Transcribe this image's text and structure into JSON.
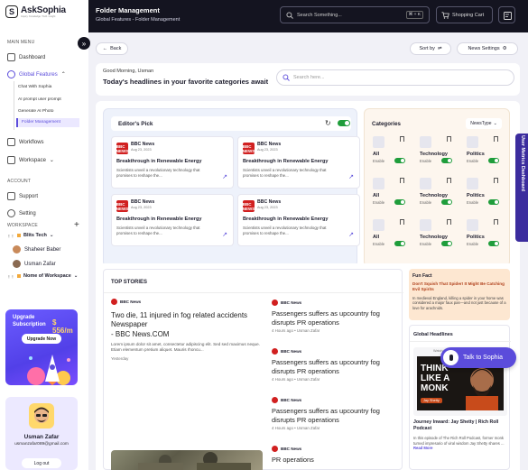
{
  "app": {
    "name": "AskSophia",
    "tagline": "Inquiry. Knowledge. Truth. Insight"
  },
  "sidebar": {
    "main_menu_label": "MAIN MENU",
    "items": [
      {
        "label": "Dashboard"
      },
      {
        "label": "Global Features"
      },
      {
        "label": "Workflows"
      },
      {
        "label": "Workspace"
      }
    ],
    "sub_items": [
      "Chat With Sophia",
      "AI prompt user prompt",
      "Generate AI Photo",
      "Folder Management"
    ],
    "account_label": "ACCOUNT",
    "account_items": [
      {
        "label": "Support"
      },
      {
        "label": "Setting"
      }
    ],
    "workspace_label": "WORKSPACE",
    "workspaces": [
      {
        "name": "Blits Tech",
        "members": [
          "Shaheer Baber",
          "Usman Zafar"
        ]
      },
      {
        "name": "Nome of Workspace"
      }
    ],
    "upgrade": {
      "line1": "Upgrade",
      "line2": "Subscription",
      "price": "$ 556/m",
      "button": "Upgrade Now"
    },
    "profile": {
      "name": "Usman Zafar",
      "email": "usmanzafar089@gmail.com",
      "logout": "Log out"
    }
  },
  "topbar": {
    "title": "Folder Management",
    "breadcrumb": "Global Features - Folder Management",
    "search_placeholder": "Search Something...",
    "shortcut": "⌘ + K",
    "cart": "Shopping Cart"
  },
  "toolbar": {
    "back": "Back",
    "sort": "Sort by",
    "news_settings": "News Settings"
  },
  "greeting": {
    "hello": "Good Morning, Usman",
    "headline": "Today's headlines in your favorite categories await",
    "search_placeholder": "Search here..."
  },
  "editors_pick": {
    "title": "Editor's Pick",
    "cards": [
      {
        "logo": "BBC NEWS",
        "source": "BBC News",
        "date": "Aug 23, 2023",
        "title": "Breakthrough in Renewable Energy",
        "desc": "Scientists unveil a revolutionary technology that promises to reshape the..."
      },
      {
        "logo": "BBC NEWS",
        "source": "BBC News",
        "date": "Aug 23, 2023",
        "title": "Breakthrough in Renewable Energy",
        "desc": "Scientists unveil a revolutionary technology that promises to reshape the..."
      },
      {
        "logo": "BBC NEWS",
        "source": "BBC News",
        "date": "Aug 23, 2023",
        "title": "Breakthrough in Renewable Energy",
        "desc": "Scientists unveil a revolutionary technology that promises to reshape the..."
      },
      {
        "logo": "BBC NEWS",
        "source": "BBC News",
        "date": "Aug 23, 2023",
        "title": "Breakthrough in Renewable Energy",
        "desc": "Scientists unveil a revolutionary technology that promises to reshape the..."
      }
    ]
  },
  "categories": {
    "title": "Categories",
    "filter": "NewsType",
    "enable_label": "Enable",
    "rows": [
      [
        "All",
        "Technology",
        "Politics"
      ],
      [
        "All",
        "Technology",
        "Politics"
      ],
      [
        "All",
        "Technology",
        "Politics"
      ]
    ]
  },
  "side_tab": "User Metrics Dashboard",
  "top_stories": {
    "title": "TOP STORIES",
    "lead": {
      "source": "BBC News",
      "title": "Two die, 11 injured in fog related accidents Newspaper - BBC News.COM",
      "title_line1": "Two die, 11 injured in fog related accidents",
      "title_line2": "Newspaper",
      "title_line3": "- BBC News.COM",
      "summary": "Lorem ipsum dolor sit amet, consectetur adipiscing elit. Sed sed maximus neque. Etiam elementum pretium aliquet. Mauris rhoncu...",
      "time": "Yesterday"
    },
    "items": [
      {
        "source": "BBC News",
        "title": "Passengers suffers as upcountry fog disrupts PR operations",
        "meta": "4 Hours ago • Usman Zafar"
      },
      {
        "source": "BBC News",
        "title": "Passengers suffers as upcountry fog disrupts PR operations",
        "meta": "4 Hours ago • Usman Zafar"
      },
      {
        "source": "BBC News",
        "title": "Passengers suffers as upcountry fog disrupts PR operations",
        "meta": "4 Hours ago • Usman Zafar"
      },
      {
        "source": "BBC News",
        "title": "PR operations",
        "meta": ""
      }
    ]
  },
  "fun_fact": {
    "label": "Fun Fact",
    "title": "Don't Squish That Spider! It Might Be Catching Evil Spirits",
    "body": "In medieval England, killing a spider in your home was considered a major faux pas—and not just because of a love for arachnids."
  },
  "global_headlines": {
    "title": "Global Headlines",
    "video_label": "Watch later",
    "thumb_text": "THINK LIKE A MONK",
    "badge": "Jay Shetty",
    "headline": "Journey Inward: Jay Shetty | Rich Roll Podcast",
    "desc": "In this episode of The Rich Roll Podcast, former monk turned impresario of viral wisdom Jay Shetty shares ...",
    "read_more": "Read More"
  },
  "talk_button": "Talk to Sophia",
  "colors": {
    "accent": "#5b4cdb",
    "dark": "#141420",
    "toggle": "#1f9d3b",
    "bbc_red": "#d12020"
  }
}
